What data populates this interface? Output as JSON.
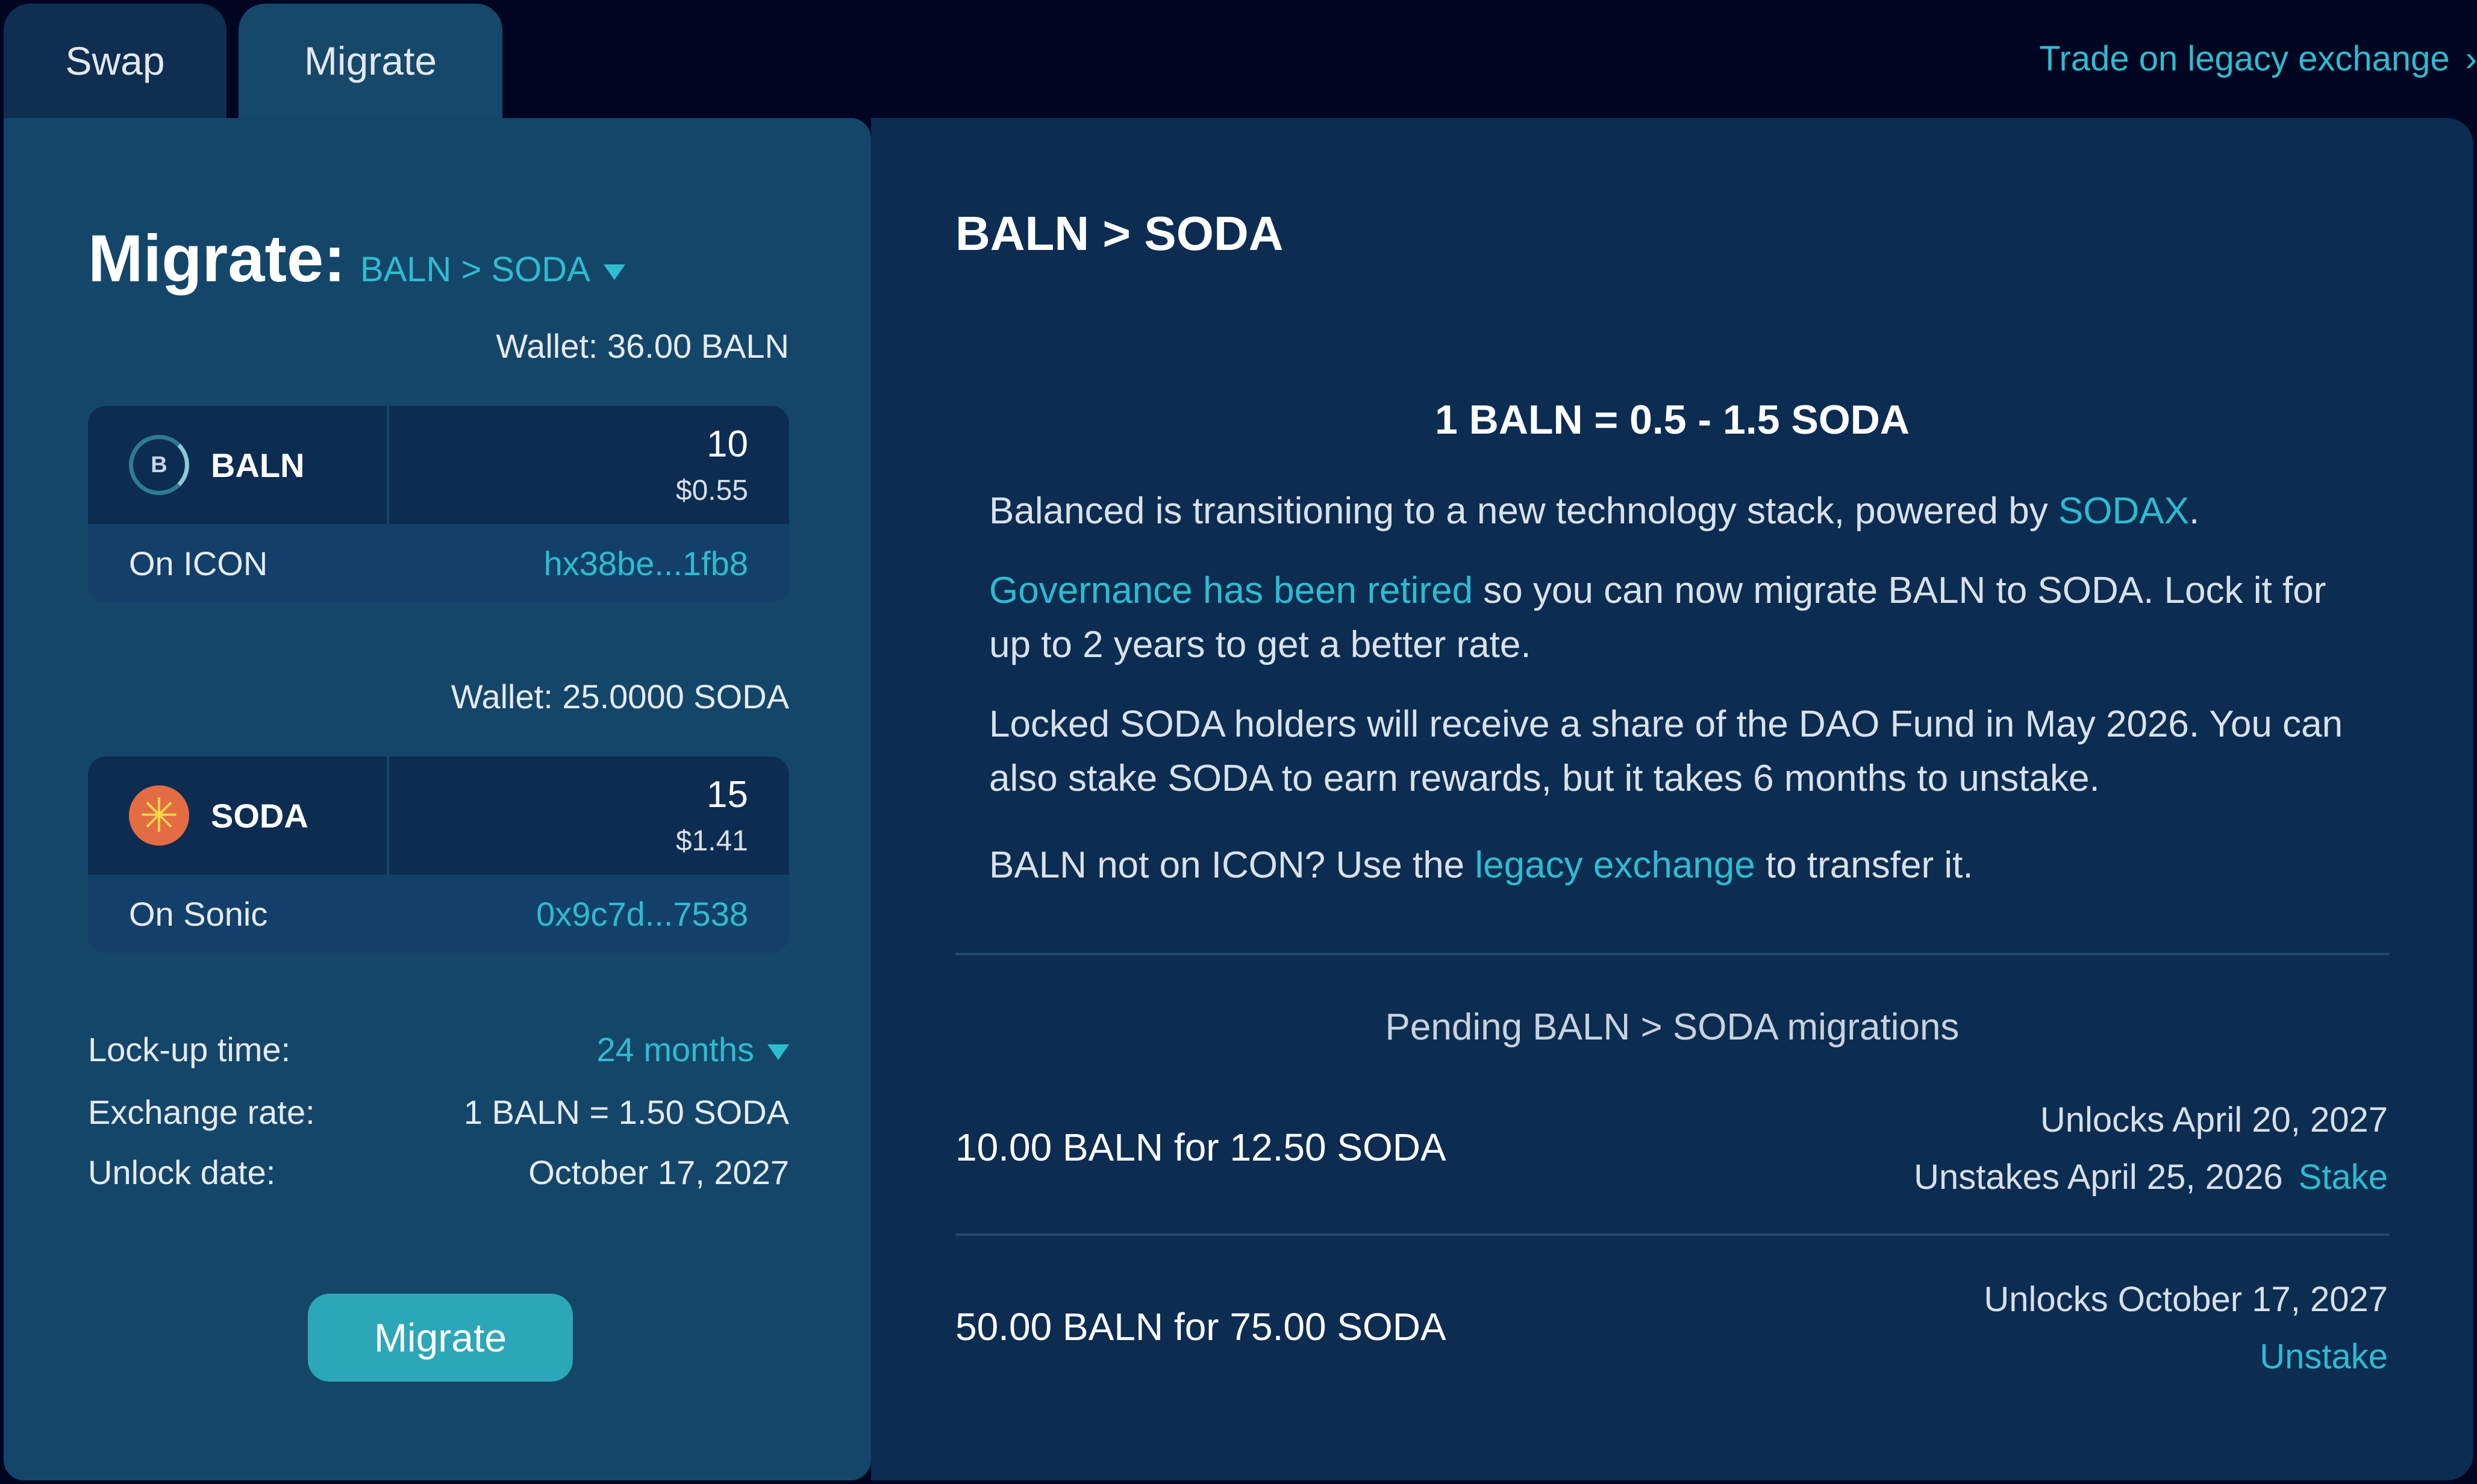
{
  "tabs": [
    {
      "label": "Swap",
      "active": false
    },
    {
      "label": "Migrate",
      "active": true
    }
  ],
  "header": {
    "legacy_link": "Trade on legacy exchange",
    "legacy_chevron": "›"
  },
  "migrate_panel": {
    "title": "Migrate:",
    "pair_selector": "BALN > SODA",
    "from": {
      "wallet": "Wallet: 36.00 BALN",
      "icon_letter": "B",
      "symbol": "BALN",
      "amount": "10",
      "usd": "$0.55",
      "network": "On ICON",
      "address": "hx38be...1fb8"
    },
    "to": {
      "wallet": "Wallet: 25.0000 SODA",
      "icon_glyph": "✳",
      "symbol": "SODA",
      "amount": "15",
      "usd": "$1.41",
      "network": "On Sonic",
      "address": "0x9c7d...7538"
    },
    "lockup": {
      "label": "Lock-up time:",
      "value": "24 months"
    },
    "exchange_rate": {
      "label": "Exchange rate:",
      "value": "1 BALN = 1.50 SODA"
    },
    "unlock_date": {
      "label": "Unlock date:",
      "value": "October 17, 2027"
    },
    "button_label": "Migrate"
  },
  "info_panel": {
    "title": "BALN > SODA",
    "rate": "1 BALN = 0.5 - 1.5 SODA",
    "p1": {
      "text": "Balanced is transitioning to a new technology stack, powered by ",
      "link": "SODAX",
      "end": "."
    },
    "p2": {
      "link": "Governance has been retired",
      "text": " so you can now migrate BALN to SODA. Lock it for up to 2 years to get a better rate."
    },
    "p3": {
      "text": "Locked SODA holders will receive a share of the DAO Fund in May 2026. You can also stake SODA to earn rewards, but it takes 6 months to unstake."
    },
    "p4": {
      "text": "BALN not on ICON? Use the ",
      "link": "legacy exchange",
      "end": " to transfer it."
    },
    "pending_title": "Pending BALN > SODA migrations",
    "migrations": [
      {
        "amount": "10.00 BALN for 12.50 SODA",
        "unlocks": "Unlocks April 20, 2027",
        "unstakes": "Unstakes April 25, 2026",
        "action": "Stake"
      },
      {
        "amount": "50.00 BALN for 75.00 SODA",
        "unlocks": "Unlocks October 17, 2027",
        "unstakes": "",
        "action": "Unstake"
      }
    ]
  },
  "colors": {
    "background": "#000522",
    "panel_left": "#14466a",
    "panel_right": "#0c2c52",
    "accent": "#2ebccf",
    "button": "#2ba7b8",
    "soda_icon": "#e46c43"
  }
}
